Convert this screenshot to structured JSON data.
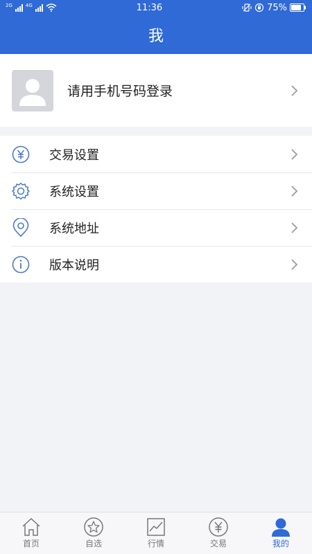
{
  "status_bar": {
    "network_1": "2G",
    "network_2": "4G",
    "time": "11:36",
    "battery": "75%"
  },
  "header": {
    "title": "我"
  },
  "profile": {
    "login_prompt": "请用手机号码登录"
  },
  "menu": [
    {
      "label": "交易设置",
      "icon": "yen-circle-icon"
    },
    {
      "label": "系统设置",
      "icon": "gear-icon"
    },
    {
      "label": "系统地址",
      "icon": "location-pin-icon"
    },
    {
      "label": "版本说明",
      "icon": "info-circle-icon"
    }
  ],
  "tabs": [
    {
      "label": "首页",
      "icon": "home-icon"
    },
    {
      "label": "自选",
      "icon": "star-icon"
    },
    {
      "label": "行情",
      "icon": "chart-icon"
    },
    {
      "label": "交易",
      "icon": "yen-circle-icon"
    },
    {
      "label": "我的",
      "icon": "user-icon",
      "active": true
    }
  ],
  "colors": {
    "primary": "#2f6ad6",
    "background": "#f2f3f7",
    "icon_blue": "#4a78c9"
  }
}
